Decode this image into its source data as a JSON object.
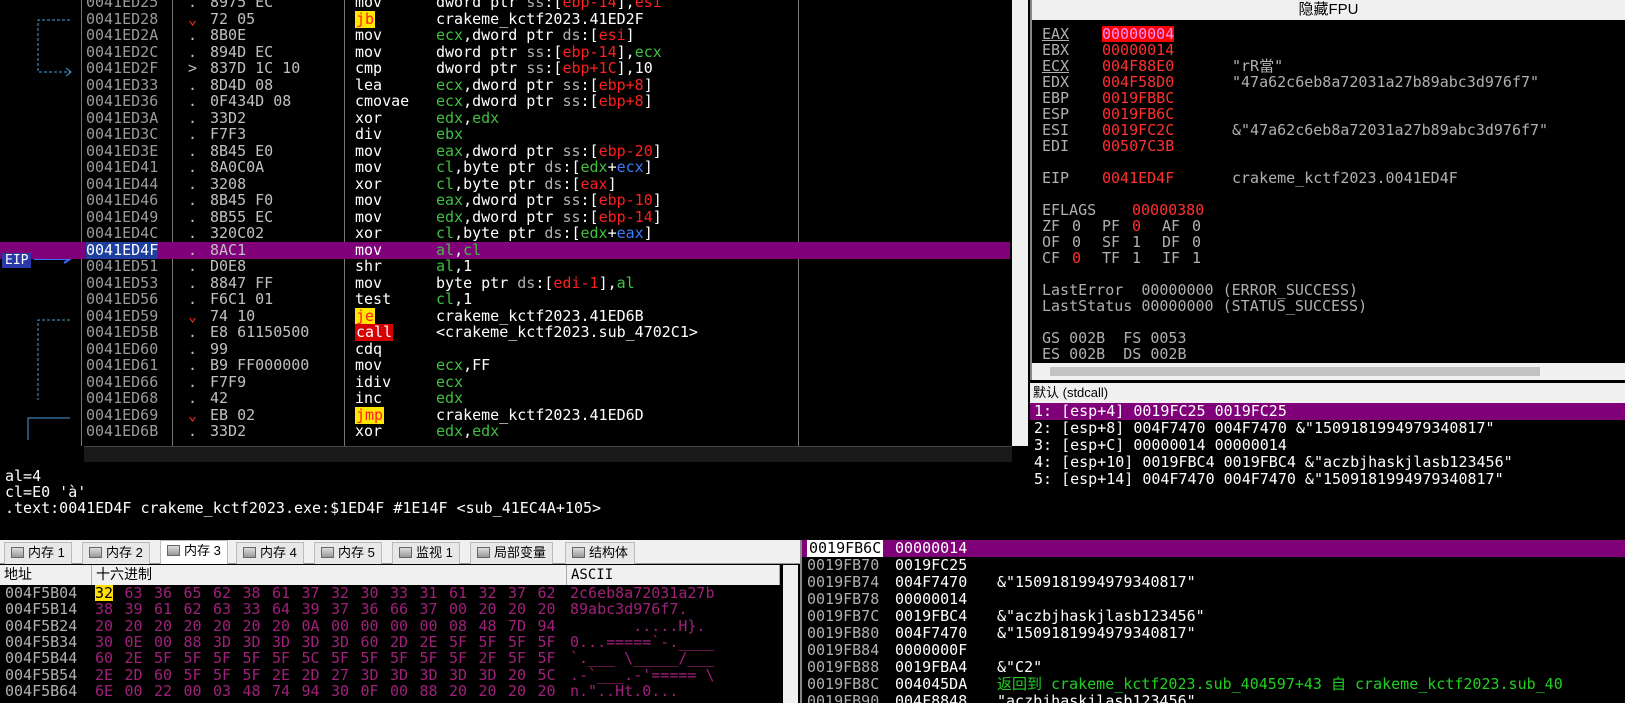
{
  "disasm": {
    "rows": [
      {
        "addr": "0041ED25",
        "mark": ".",
        "hex": "8975 EC",
        "mn": "mov",
        "op": [
          [
            "w",
            "dword ptr "
          ],
          [
            "m",
            "ss"
          ],
          [
            "w",
            ":["
          ],
          [
            "r",
            "ebp-14"
          ],
          [
            "w",
            "],"
          ],
          [
            "r",
            "esi"
          ]
        ]
      },
      {
        "addr": "0041ED28",
        "mark": "⌄",
        "hex": "72 05",
        "mn": "jb",
        "mnk": "jmp",
        "op": [
          [
            "w",
            "crakeme_kctf2023.41ED2F"
          ]
        ]
      },
      {
        "addr": "0041ED2A",
        "mark": ".",
        "hex": "8B0E",
        "mn": "mov",
        "op": [
          [
            "g",
            "ecx"
          ],
          [
            "w",
            ",dword ptr "
          ],
          [
            "m",
            "ds"
          ],
          [
            "w",
            ":["
          ],
          [
            "r",
            "esi"
          ],
          [
            "w",
            "]"
          ]
        ]
      },
      {
        "addr": "0041ED2C",
        "mark": ".",
        "hex": "894D EC",
        "mn": "mov",
        "op": [
          [
            "w",
            "dword ptr "
          ],
          [
            "m",
            "ss"
          ],
          [
            "w",
            ":["
          ],
          [
            "r",
            "ebp-14"
          ],
          [
            "w",
            "],"
          ],
          [
            "g",
            "ecx"
          ]
        ]
      },
      {
        "addr": "0041ED2F",
        "mark": ">",
        "hex": "837D 1C 10",
        "mn": "cmp",
        "op": [
          [
            "w",
            "dword ptr "
          ],
          [
            "m",
            "ss"
          ],
          [
            "w",
            ":["
          ],
          [
            "r",
            "ebp+1C"
          ],
          [
            "w",
            "],10"
          ]
        ]
      },
      {
        "addr": "0041ED33",
        "mark": ".",
        "hex": "8D4D 08",
        "mn": "lea",
        "op": [
          [
            "g",
            "ecx"
          ],
          [
            "w",
            ",dword ptr "
          ],
          [
            "m",
            "ss"
          ],
          [
            "w",
            ":["
          ],
          [
            "r",
            "ebp+8"
          ],
          [
            "w",
            "]"
          ]
        ]
      },
      {
        "addr": "0041ED36",
        "mark": ".",
        "hex": "0F434D 08",
        "mn": "cmovae",
        "op": [
          [
            "g",
            "ecx"
          ],
          [
            "w",
            ",dword ptr "
          ],
          [
            "m",
            "ss"
          ],
          [
            "w",
            ":["
          ],
          [
            "r",
            "ebp+8"
          ],
          [
            "w",
            "]"
          ]
        ]
      },
      {
        "addr": "0041ED3A",
        "mark": ".",
        "hex": "33D2",
        "mn": "xor",
        "op": [
          [
            "g",
            "edx"
          ],
          [
            "w",
            ","
          ],
          [
            "g",
            "edx"
          ]
        ]
      },
      {
        "addr": "0041ED3C",
        "mark": ".",
        "hex": "F7F3",
        "mn": "div",
        "op": [
          [
            "g",
            "ebx"
          ]
        ]
      },
      {
        "addr": "0041ED3E",
        "mark": ".",
        "hex": "8B45 E0",
        "mn": "mov",
        "op": [
          [
            "g",
            "eax"
          ],
          [
            "w",
            ",dword ptr "
          ],
          [
            "m",
            "ss"
          ],
          [
            "w",
            ":["
          ],
          [
            "r",
            "ebp-20"
          ],
          [
            "w",
            "]"
          ]
        ]
      },
      {
        "addr": "0041ED41",
        "mark": ".",
        "hex": "8A0C0A",
        "mn": "mov",
        "op": [
          [
            "g",
            "cl"
          ],
          [
            "w",
            ",byte ptr "
          ],
          [
            "m",
            "ds"
          ],
          [
            "w",
            ":["
          ],
          [
            "g",
            "edx"
          ],
          [
            "w",
            "+"
          ],
          [
            "b",
            "ecx"
          ],
          [
            "w",
            "]"
          ]
        ]
      },
      {
        "addr": "0041ED44",
        "mark": ".",
        "hex": "3208",
        "mn": "xor",
        "op": [
          [
            "g",
            "cl"
          ],
          [
            "w",
            ",byte ptr "
          ],
          [
            "m",
            "ds"
          ],
          [
            "w",
            ":["
          ],
          [
            "r",
            "eax"
          ],
          [
            "w",
            "]"
          ]
        ]
      },
      {
        "addr": "0041ED46",
        "mark": ".",
        "hex": "8B45 F0",
        "mn": "mov",
        "op": [
          [
            "g",
            "eax"
          ],
          [
            "w",
            ",dword ptr "
          ],
          [
            "m",
            "ss"
          ],
          [
            "w",
            ":["
          ],
          [
            "r",
            "ebp-10"
          ],
          [
            "w",
            "]"
          ]
        ]
      },
      {
        "addr": "0041ED49",
        "mark": ".",
        "hex": "8B55 EC",
        "mn": "mov",
        "op": [
          [
            "g",
            "edx"
          ],
          [
            "w",
            ",dword ptr "
          ],
          [
            "m",
            "ss"
          ],
          [
            "w",
            ":["
          ],
          [
            "r",
            "ebp-14"
          ],
          [
            "w",
            "]"
          ]
        ]
      },
      {
        "addr": "0041ED4C",
        "mark": ".",
        "hex": "320C02",
        "mn": "xor",
        "op": [
          [
            "g",
            "cl"
          ],
          [
            "w",
            ",byte ptr "
          ],
          [
            "m",
            "ds"
          ],
          [
            "w",
            ":["
          ],
          [
            "g",
            "edx"
          ],
          [
            "w",
            "+"
          ],
          [
            "b",
            "eax"
          ],
          [
            "w",
            "]"
          ]
        ]
      },
      {
        "addr": "0041ED4F",
        "mark": ".",
        "hex": "8AC1",
        "mn": "mov",
        "eip": true,
        "op": [
          [
            "g",
            "al"
          ],
          [
            "w",
            ","
          ],
          [
            "g",
            "cl"
          ]
        ]
      },
      {
        "addr": "0041ED51",
        "mark": ".",
        "hex": "D0E8",
        "mn": "shr",
        "op": [
          [
            "g",
            "al"
          ],
          [
            "w",
            ",1"
          ]
        ]
      },
      {
        "addr": "0041ED53",
        "mark": ".",
        "hex": "8847 FF",
        "mn": "mov",
        "op": [
          [
            "w",
            "byte ptr "
          ],
          [
            "m",
            "ds"
          ],
          [
            "w",
            ":["
          ],
          [
            "r",
            "edi-1"
          ],
          [
            "w",
            "],"
          ],
          [
            "g",
            "al"
          ]
        ]
      },
      {
        "addr": "0041ED56",
        "mark": ".",
        "hex": "F6C1 01",
        "mn": "test",
        "op": [
          [
            "g",
            "cl"
          ],
          [
            "w",
            ",1"
          ]
        ]
      },
      {
        "addr": "0041ED59",
        "mark": "⌄",
        "hex": "74 10",
        "mn": "je",
        "mnk": "jmp",
        "op": [
          [
            "w",
            "crakeme_kctf2023.41ED6B"
          ]
        ]
      },
      {
        "addr": "0041ED5B",
        "mark": ".",
        "hex": "E8 61150500",
        "mn": "call",
        "mnk": "call",
        "op": [
          [
            "w",
            "<crakeme_kctf2023.sub_4702C1>"
          ]
        ]
      },
      {
        "addr": "0041ED60",
        "mark": ".",
        "hex": "99",
        "mn": "cdq",
        "op": []
      },
      {
        "addr": "0041ED61",
        "mark": ".",
        "hex": "B9 FF000000",
        "mn": "mov",
        "op": [
          [
            "g",
            "ecx"
          ],
          [
            "w",
            ",FF"
          ]
        ]
      },
      {
        "addr": "0041ED66",
        "mark": ".",
        "hex": "F7F9",
        "mn": "idiv",
        "op": [
          [
            "g",
            "ecx"
          ]
        ]
      },
      {
        "addr": "0041ED68",
        "mark": ".",
        "hex": "42",
        "mn": "inc",
        "op": [
          [
            "g",
            "edx"
          ]
        ]
      },
      {
        "addr": "0041ED69",
        "mark": "⌄",
        "hex": "EB 02",
        "mn": "jmp",
        "mnk": "jmp",
        "op": [
          [
            "w",
            "crakeme_kctf2023.41ED6D"
          ]
        ]
      },
      {
        "addr": "0041ED6B",
        "mark": ".",
        "hex": "33D2",
        "mn": "xor",
        "op": [
          [
            "g",
            "edx"
          ],
          [
            "w",
            ","
          ],
          [
            "g",
            "edx"
          ]
        ]
      }
    ],
    "eip_badge": "EIP"
  },
  "info": {
    "line1": "al=4",
    "line2": "cl=E0 'à'",
    "line3": "",
    "line4": ".text:0041ED4F crakeme_kctf2023.exe:$1ED4F #1E14F <sub_41EC4A+105>"
  },
  "regs": {
    "title": "隐藏FPU",
    "lines": [
      {
        "n": "EAX",
        "v": "00000004",
        "c": "",
        "hl": true,
        "u": true
      },
      {
        "n": "EBX",
        "v": "00000014",
        "c": ""
      },
      {
        "n": "ECX",
        "v": "004F88E0",
        "c": "\"rR當\"",
        "u": true
      },
      {
        "n": "EDX",
        "v": "004F58D0",
        "c": "\"47a62c6eb8a72031a27b89abc3d976f7\""
      },
      {
        "n": "EBP",
        "v": "0019FBBC",
        "c": ""
      },
      {
        "n": "ESP",
        "v": "0019FB6C",
        "c": ""
      },
      {
        "n": "ESI",
        "v": "0019FC2C",
        "c": "&\"47a62c6eb8a72031a27b89abc3d976f7\""
      },
      {
        "n": "EDI",
        "v": "00507C3B",
        "c": ""
      },
      {
        "n": "",
        "v": "",
        "c": ""
      },
      {
        "n": "EIP",
        "v": "0041ED4F",
        "c": "crakeme_kctf2023.0041ED4F"
      }
    ],
    "eflags_label": "EFLAGS",
    "eflags_val": "00000380",
    "flags": [
      [
        [
          "ZF",
          "0",
          false
        ],
        [
          "PF",
          "0",
          true
        ],
        [
          "AF",
          "0",
          false
        ]
      ],
      [
        [
          "OF",
          "0",
          false
        ],
        [
          "SF",
          "1",
          false
        ],
        [
          "DF",
          "0",
          false
        ]
      ],
      [
        [
          "CF",
          "0",
          true
        ],
        [
          "TF",
          "1",
          false
        ],
        [
          "IF",
          "1",
          false
        ]
      ]
    ],
    "lasterror": "LastError  00000000 (ERROR_SUCCESS)",
    "laststatus": "LastStatus 00000000 (STATUS_SUCCESS)",
    "seg1": "GS 002B  FS 0053",
    "seg2": "ES 002B  DS 002B"
  },
  "callconv": "默认 (stdcall)",
  "args": [
    "1: [esp+4] 0019FC25 0019FC25",
    "2: [esp+8] 004F7470 004F7470 &\"1509181994979340817\"",
    "3: [esp+C] 00000014 00000014",
    "4: [esp+10] 0019FBC4 0019FBC4 &\"aczbjhaskjlasb123456\"",
    "5: [esp+14] 004F7470 004F7470 &\"1509181994979340817\""
  ],
  "tabs": [
    {
      "label": "内存 1"
    },
    {
      "label": "内存 2"
    },
    {
      "label": "内存 3",
      "active": true
    },
    {
      "label": "内存 4"
    },
    {
      "label": "内存 5"
    },
    {
      "label": "监视 1"
    },
    {
      "label": "局部变量"
    },
    {
      "label": "结构体"
    }
  ],
  "dump": {
    "hdr_addr": "地址",
    "hdr_hex": "十六进制",
    "hdr_ascii": "ASCII",
    "rows": [
      {
        "a": "004F5B04",
        "h": [
          "32",
          "63",
          "36",
          "65",
          "62",
          "38",
          "61",
          "37",
          "32",
          "30",
          "33",
          "31",
          "61",
          "32",
          "37",
          "62"
        ],
        "s": "2c6eb8a72031a27b"
      },
      {
        "a": "004F5B14",
        "h": [
          "38",
          "39",
          "61",
          "62",
          "63",
          "33",
          "64",
          "39",
          "37",
          "36",
          "66",
          "37",
          "00",
          "20",
          "20",
          "20"
        ],
        "s": "89abc3d976f7.   "
      },
      {
        "a": "004F5B24",
        "h": [
          "20",
          "20",
          "20",
          "20",
          "20",
          "20",
          "20",
          "0A",
          "00",
          "00",
          "00",
          "00",
          "08",
          "48",
          "7D",
          "94"
        ],
        "s": "       .....H}."
      },
      {
        "a": "004F5B34",
        "h": [
          "30",
          "0E",
          "00",
          "88",
          "3D",
          "3D",
          "3D",
          "3D",
          "3D",
          "60",
          "2D",
          "2E",
          "5F",
          "5F",
          "5F",
          "5F"
        ],
        "s": "0...=====`-.____"
      },
      {
        "a": "004F5B44",
        "h": [
          "60",
          "2E",
          "5F",
          "5F",
          "5F",
          "5F",
          "5F",
          "5C",
          "5F",
          "5F",
          "5F",
          "5F",
          "5F",
          "2F",
          "5F",
          "5F"
        ],
        "s": "`.___ \\_____/___"
      },
      {
        "a": "004F5B54",
        "h": [
          "2E",
          "2D",
          "60",
          "5F",
          "5F",
          "5F",
          "2E",
          "2D",
          "27",
          "3D",
          "3D",
          "3D",
          "3D",
          "3D",
          "20",
          "5C"
        ],
        "s": ".-`___.-'===== \\"
      },
      {
        "a": "004F5B64",
        "h": [
          "6E",
          "00",
          "22",
          "00",
          "03",
          "48",
          "74",
          "94",
          "30",
          "0F",
          "00",
          "88",
          "20",
          "20",
          "20",
          "20"
        ],
        "s": "n.\"..Ht.0...    "
      }
    ]
  },
  "stack": [
    {
      "a": "0019FB6C",
      "v": "00000014",
      "c": "",
      "sel": true
    },
    {
      "a": "0019FB70",
      "v": "0019FC25",
      "c": ""
    },
    {
      "a": "0019FB74",
      "v": "004F7470",
      "c": "&\"1509181994979340817\""
    },
    {
      "a": "0019FB78",
      "v": "00000014",
      "c": ""
    },
    {
      "a": "0019FB7C",
      "v": "0019FBC4",
      "c": "&\"aczbjhaskjlasb123456\""
    },
    {
      "a": "0019FB80",
      "v": "004F7470",
      "c": "&\"1509181994979340817\""
    },
    {
      "a": "0019FB84",
      "v": "0000000F",
      "c": ""
    },
    {
      "a": "0019FB88",
      "v": "0019FBA4",
      "c": "&\"C2\""
    },
    {
      "a": "0019FB8C",
      "v": "004045DA",
      "c": "返回到 crakeme_kctf2023.sub_404597+43 自 crakeme_kctf2023.sub_40",
      "ret": true
    },
    {
      "a": "0019FB90",
      "v": "004F8848",
      "c": "\"aczbjhaskjlasb123456\""
    }
  ]
}
